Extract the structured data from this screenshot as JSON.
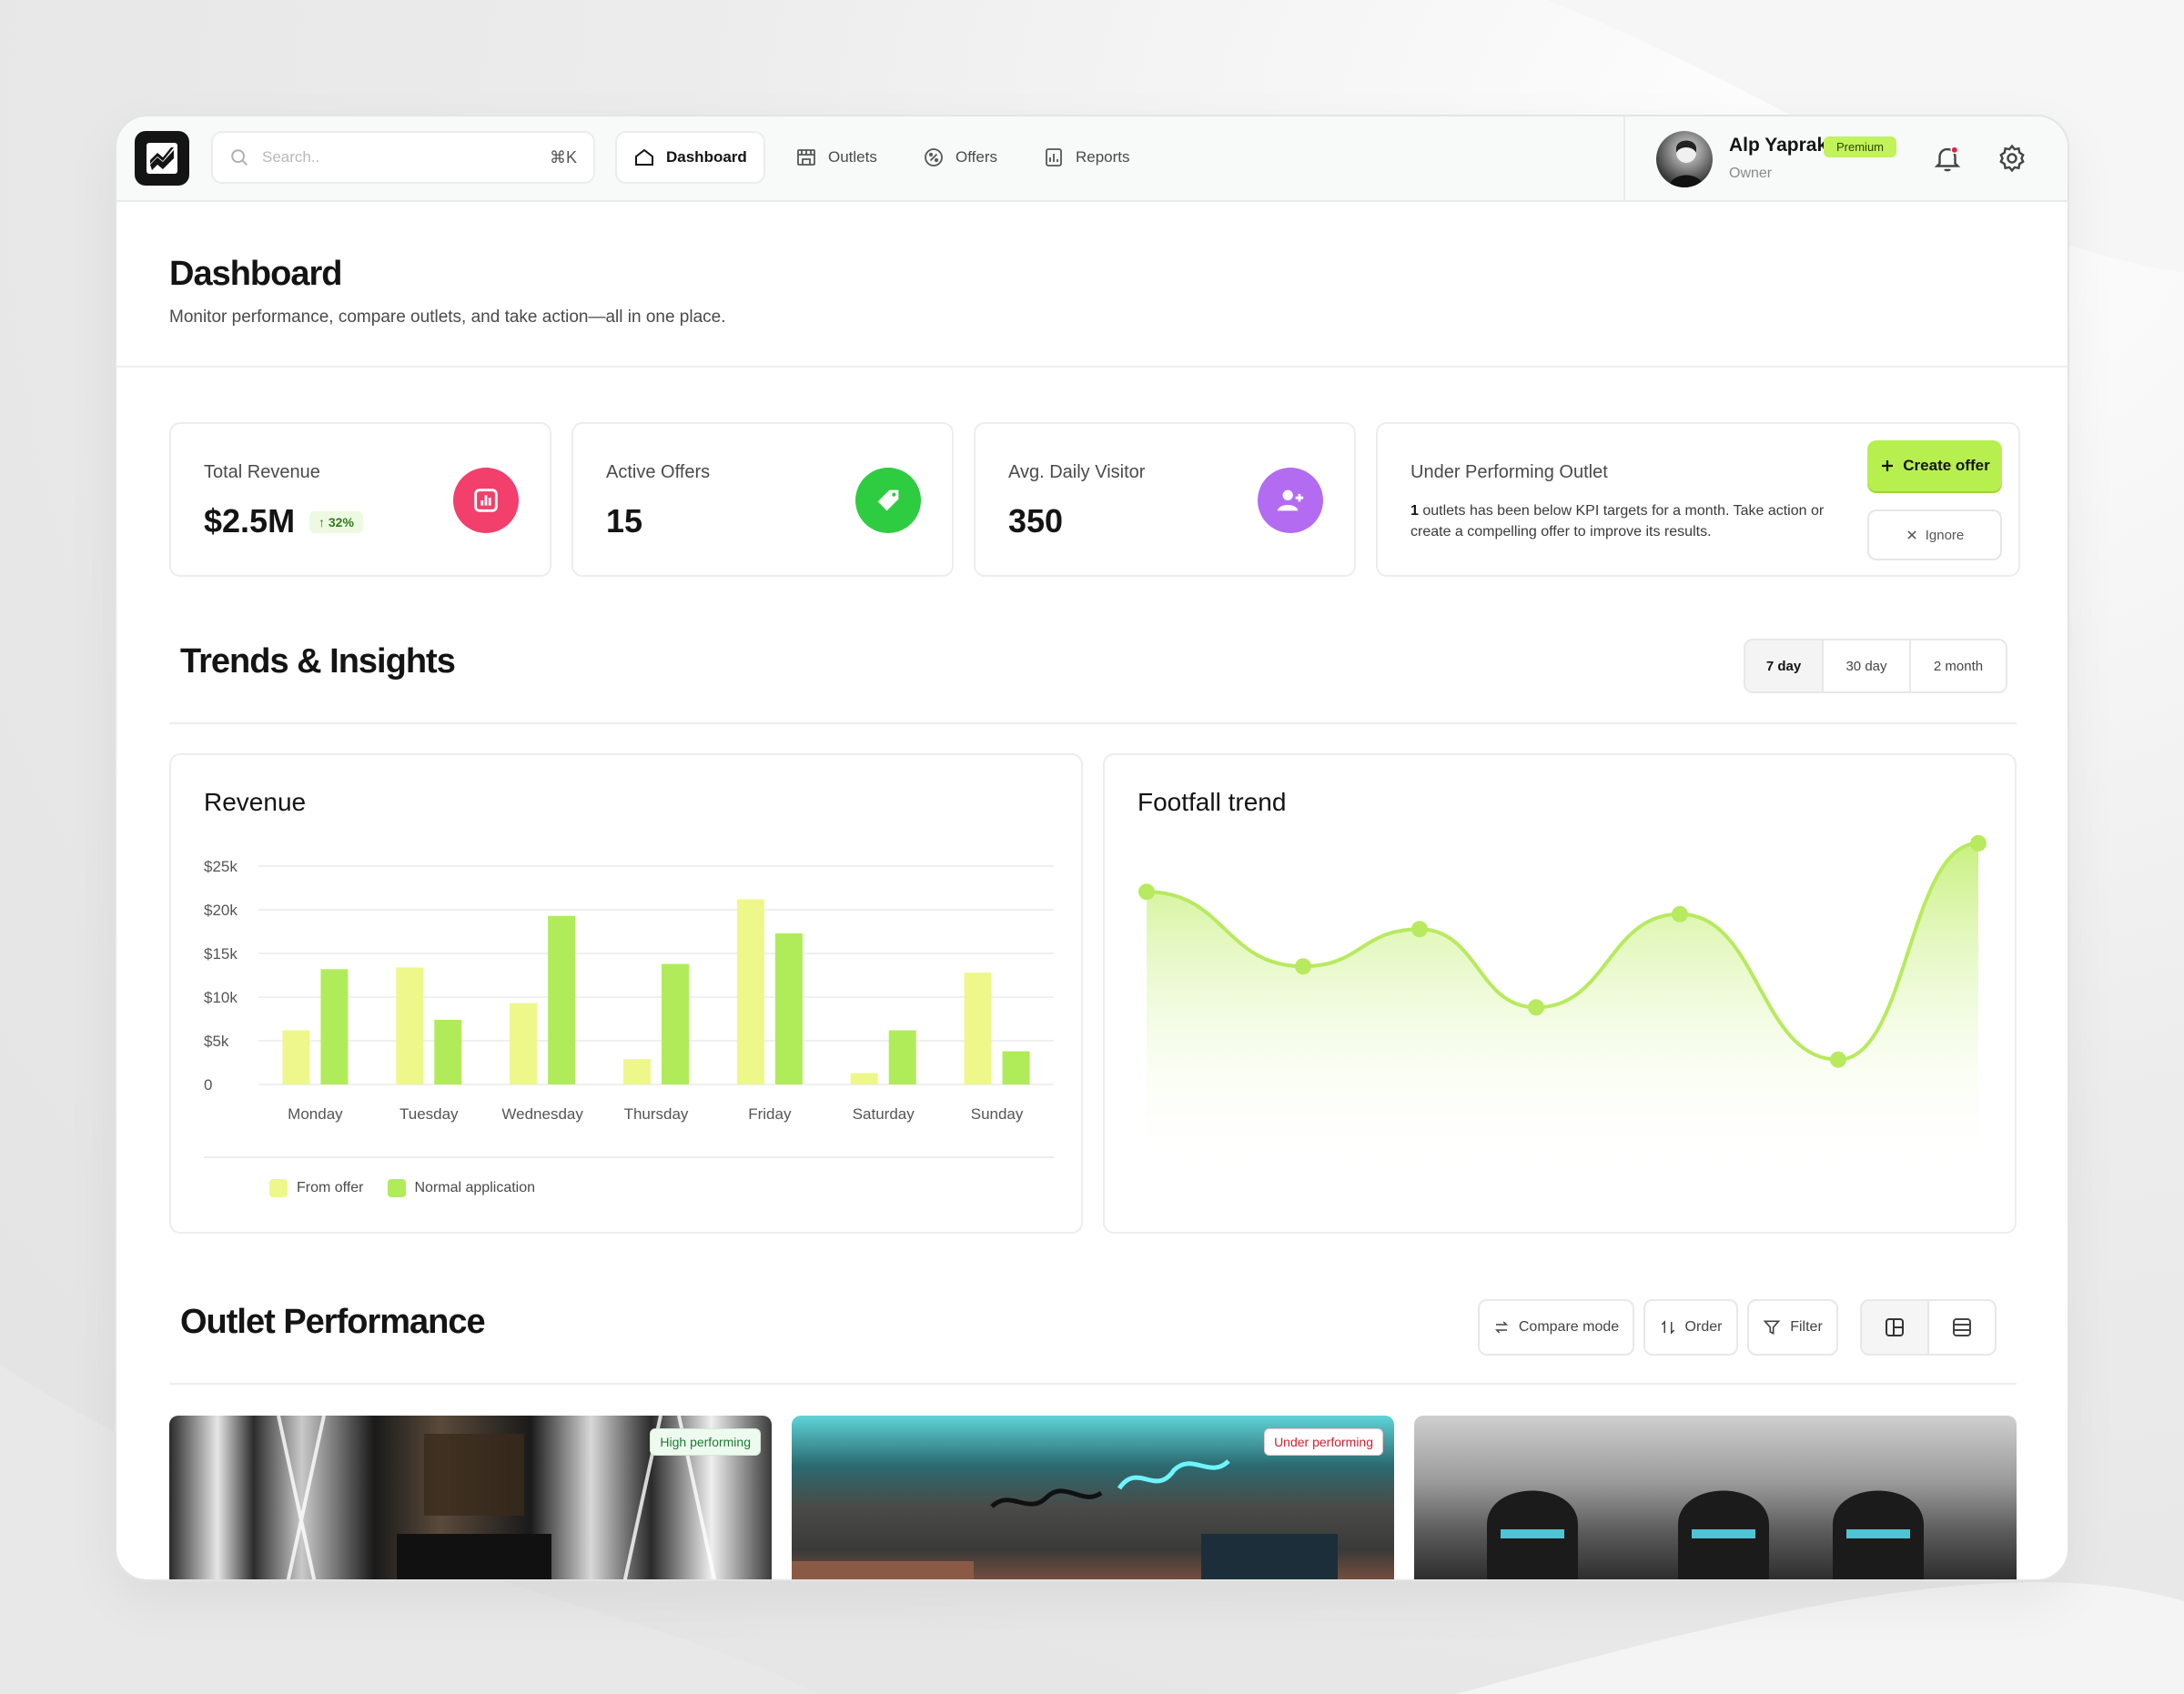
{
  "nav": {
    "search_placeholder": "Search..",
    "search_shortcut": "⌘K",
    "tabs": [
      {
        "label": "Dashboard",
        "icon": "home-icon",
        "active": true
      },
      {
        "label": "Outlets",
        "icon": "building-icon",
        "active": false
      },
      {
        "label": "Offers",
        "icon": "percent-badge-icon",
        "active": false
      },
      {
        "label": "Reports",
        "icon": "report-chart-icon",
        "active": false
      }
    ]
  },
  "user": {
    "name": "Alp Yaprak",
    "badge": "Premium",
    "role": "Owner"
  },
  "header": {
    "title": "Dashboard",
    "subtitle": "Monitor performance, compare outlets, and take action—all in one place."
  },
  "kpis": [
    {
      "label": "Total Revenue",
      "value": "$2.5M",
      "change": "32%",
      "icon": "bar-chart-icon",
      "color": "#f23f6b"
    },
    {
      "label": "Active Offers",
      "value": "15",
      "icon": "tag-icon",
      "color": "#2ecc40"
    },
    {
      "label": "Avg. Daily Visitor",
      "value": "350",
      "icon": "user-plus-icon",
      "color": "#b36bf2"
    }
  ],
  "under": {
    "title": "Under Performing Outlet",
    "count": "1",
    "text": " outlets has been below KPI targets for a month. Take action or create a compelling offer to improve its results.",
    "create_label": "Create offer",
    "ignore_label": "Ignore"
  },
  "trends": {
    "title": "Trends & Insights",
    "ranges": [
      "7 day",
      "30 day",
      "2 month"
    ],
    "active_range": "7 day"
  },
  "revenue_card_title": "Revenue",
  "footfall_card_title": "Footfall trend",
  "chart_data": [
    {
      "type": "bar",
      "title": "Revenue",
      "categories": [
        "Monday",
        "Tuesday",
        "Wednesday",
        "Thursday",
        "Friday",
        "Saturday",
        "Sunday"
      ],
      "series": [
        {
          "name": "From offer",
          "color": "#eef78a",
          "values": [
            6200,
            13400,
            9300,
            2900,
            21200,
            1300,
            12800
          ]
        },
        {
          "name": "Normal application",
          "color": "#b0ec5a",
          "values": [
            13200,
            7400,
            19300,
            13800,
            17300,
            6200,
            3800
          ]
        }
      ],
      "y_ticks": [
        "$25k",
        "$20k",
        "$15k",
        "$10k",
        "$5k",
        "0"
      ],
      "ylim": [
        0,
        25000
      ],
      "grid": true,
      "legend": "bottom-left"
    },
    {
      "type": "area",
      "title": "Footfall trend",
      "x": [
        1,
        2,
        3,
        4,
        5,
        6,
        7
      ],
      "values": [
        78,
        58,
        68,
        47,
        72,
        33,
        91
      ],
      "color": "#b7ea5e",
      "axes": false
    }
  ],
  "outlets": {
    "title": "Outlet Performance",
    "tools": [
      {
        "label": "Compare mode",
        "icon": "swap-arrows-icon"
      },
      {
        "label": "Order",
        "icon": "sort-arrows-icon"
      },
      {
        "label": "Filter",
        "icon": "filter-funnel-icon"
      }
    ],
    "cards": [
      {
        "tag": "High performing",
        "tag_color": "#1c7a34"
      },
      {
        "tag": "Under performing",
        "tag_color": "#d01f2e"
      },
      {
        "tag": ""
      }
    ]
  }
}
